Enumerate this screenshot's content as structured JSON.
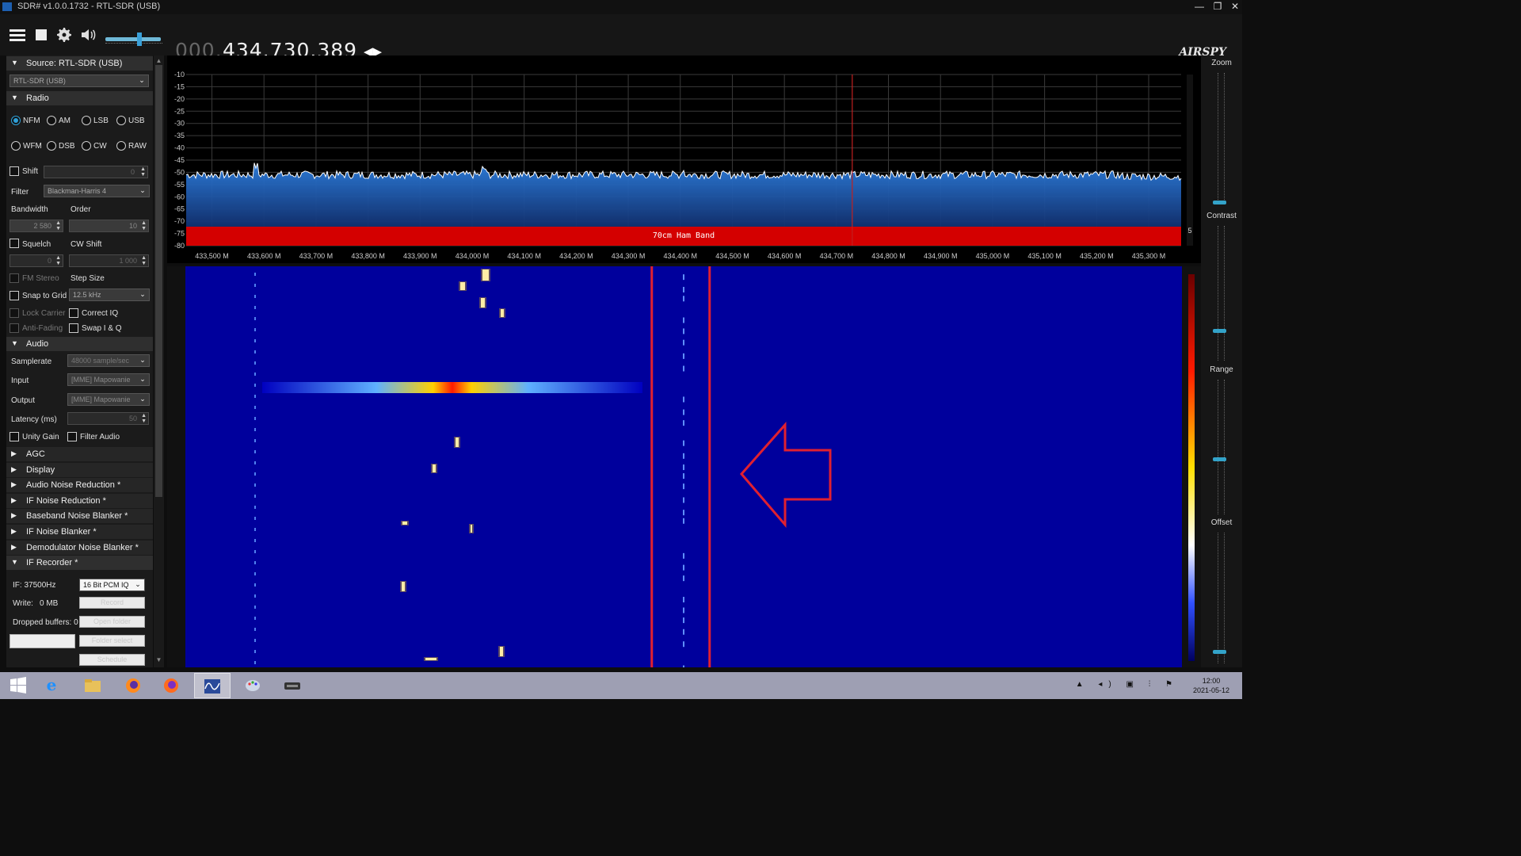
{
  "window": {
    "title": "SDR# v1.0.0.1732 - RTL-SDR (USB)",
    "controls": {
      "minimize": "—",
      "restore": "❐",
      "close": "✕"
    }
  },
  "toolbar": {
    "menu_icon": "hamburger-menu-icon",
    "stop_icon": "stop-icon",
    "settings_icon": "gear-icon",
    "volume_icon": "speaker-icon",
    "volume_level": 0.62,
    "frequency_prefix": "000.",
    "frequency_main": "434.730.389",
    "tune_arrows": "◀▶",
    "brand": "AIRSPY"
  },
  "panel": {
    "source": {
      "header": "Source: RTL-SDR (USB)",
      "device": "RTL-SDR (USB)"
    },
    "radio": {
      "header": "Radio",
      "modes_row1": [
        "NFM",
        "AM",
        "LSB",
        "USB"
      ],
      "modes_row2": [
        "WFM",
        "DSB",
        "CW",
        "RAW"
      ],
      "selected_mode": "NFM",
      "shift_label": "Shift",
      "shift_value": "0",
      "filter_label": "Filter",
      "filter_value": "Blackman-Harris 4",
      "bandwidth_label": "Bandwidth",
      "bandwidth_value": "2 580",
      "order_label": "Order",
      "order_value": "10",
      "squelch_label": "Squelch",
      "squelch_value": "0",
      "cw_shift_label": "CW Shift",
      "cw_shift_value": "1 000",
      "fm_stereo_label": "FM Stereo",
      "step_size_label": "Step Size",
      "snap_label": "Snap to Grid",
      "step_value": "12.5 kHz",
      "lock_carrier_label": "Lock Carrier",
      "correct_iq_label": "Correct IQ",
      "anti_fading_label": "Anti-Fading",
      "swap_iq_label": "Swap I & Q"
    },
    "audio": {
      "header": "Audio",
      "samplerate_label": "Samplerate",
      "samplerate_value": "48000 sample/sec",
      "input_label": "Input",
      "input_value": "[MME] Mapowanie",
      "output_label": "Output",
      "output_value": "[MME] Mapowanie",
      "latency_label": "Latency (ms)",
      "latency_value": "50",
      "unity_gain_label": "Unity Gain",
      "filter_audio_label": "Filter Audio"
    },
    "collapsed_sections": [
      "AGC",
      "Display",
      "Audio Noise Reduction *",
      "IF Noise Reduction *",
      "Baseband Noise Blanker *",
      "IF Noise Blanker *",
      "Demodulator Noise Blanker *"
    ],
    "recorder": {
      "header": "IF Recorder *",
      "if_label": "IF: 37500Hz",
      "format_value": "16 Bit PCM IQ",
      "write_label": "Write:",
      "write_value": "0 MB",
      "record_button": "Record",
      "dropped_label": "Dropped buffers: 0",
      "open_folder_button": "Open folder",
      "folder_select_button": "Folder select",
      "schedule_button": "Schedule"
    }
  },
  "spectrum": {
    "db_labels": [
      "-10",
      "-15",
      "-20",
      "-25",
      "-30",
      "-35",
      "-40",
      "-45",
      "-50",
      "-55",
      "-60",
      "-65",
      "-70",
      "-75",
      "-80"
    ],
    "freq_labels": [
      "433,500 M",
      "433,600 M",
      "433,700 M",
      "433,800 M",
      "433,900 M",
      "434,000 M",
      "434,100 M",
      "434,200 M",
      "434,300 M",
      "434,400 M",
      "434,500 M",
      "434,600 M",
      "434,700 M",
      "434,800 M",
      "434,900 M",
      "435,000 M",
      "435,100 M",
      "435,200 M",
      "435,300 M"
    ],
    "band_label": "70cm Ham Band",
    "side_value": "5",
    "noise_floor_db": -51,
    "tuned_freq_mhz": 434.7304,
    "colors": {
      "band": "#d40000",
      "fill": "#1455b8",
      "line": "#ffffff",
      "tuned": "#c02020"
    }
  },
  "waterfall": {
    "highlight_freq_mhz": 434.4,
    "annotation_color": "#e02030"
  },
  "right_panel": {
    "zoom_label": "Zoom",
    "contrast_label": "Contrast",
    "range_label": "Range",
    "offset_label": "Offset"
  },
  "taskbar": {
    "start_icon": "windows-start-icon",
    "apps": [
      "internet-explorer-icon",
      "file-explorer-icon",
      "firefox-icon",
      "firefox-icon-2",
      "sdrsharp-icon",
      "paint-icon",
      "tape-drive-icon"
    ],
    "active_app": "sdrsharp-icon",
    "clock_time": "12:00",
    "clock_date": "2021-05-12"
  }
}
